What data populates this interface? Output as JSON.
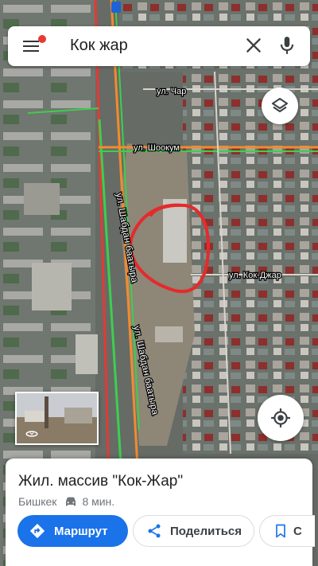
{
  "search": {
    "query": "Кок жар"
  },
  "map": {
    "street_labels": [
      "ул. Чар",
      "ул. Шоокум",
      "ул. Кок-Джар",
      "ул. Шабдан баатыра",
      "ул. Шабдан баатыра"
    ],
    "colors": {
      "main_road": "#f28b2e",
      "green_road": "#3ccf4e",
      "red_road": "#e53935",
      "circle": "#e52a2a"
    }
  },
  "place": {
    "title": "Жил. массив \"Кок-Жар\"",
    "city": "Бишкек",
    "travel_time": "8 мин."
  },
  "actions": {
    "route_label": "Маршрут",
    "share_label": "Поделиться",
    "save_label": "С"
  },
  "icons": [
    "menu-icon",
    "close-icon",
    "mic-icon",
    "layers-icon",
    "my-location-icon",
    "car-icon",
    "directions-icon",
    "share-icon",
    "bookmark-icon",
    "street-view-icon"
  ],
  "accent": "#1a73e8"
}
